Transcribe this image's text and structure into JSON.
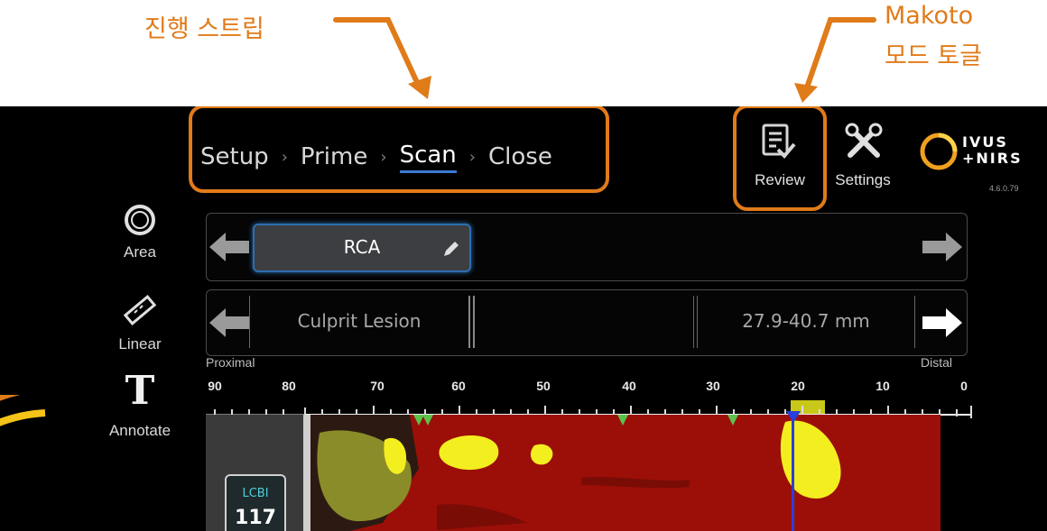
{
  "callouts": {
    "progress_strip": "진행 스트립",
    "makoto_line1": "Makoto",
    "makoto_line2": "모드 토글"
  },
  "breadcrumb": {
    "setup": "Setup",
    "prime": "Prime",
    "scan": "Scan",
    "close": "Close",
    "separator": "›",
    "active": "Scan"
  },
  "top_buttons": {
    "review": "Review",
    "settings": "Settings"
  },
  "logo": {
    "line1": "IVUS",
    "line2": "+NIRS",
    "version": "4.6.0.79"
  },
  "tools": {
    "area": "Area",
    "linear": "Linear",
    "annotate_glyph": "T",
    "annotate": "Annotate"
  },
  "vessel_selector": {
    "value": "RCA"
  },
  "lesion_selector": {
    "name": "Culprit Lesion",
    "range": "27.9-40.7 mm"
  },
  "ruler": {
    "proximal": "Proximal",
    "distal": "Distal",
    "ticks": [
      "90",
      "80",
      "70",
      "60",
      "50",
      "40",
      "30",
      "20",
      "10",
      "0"
    ]
  },
  "lcbi": {
    "label": "LCBI",
    "value": "117"
  },
  "colors": {
    "orange": "#e07b1a",
    "accent_blue": "#3a7bd5",
    "chemogram_red": "#9c0f08",
    "lipid_yellow": "#f3ee1f"
  }
}
